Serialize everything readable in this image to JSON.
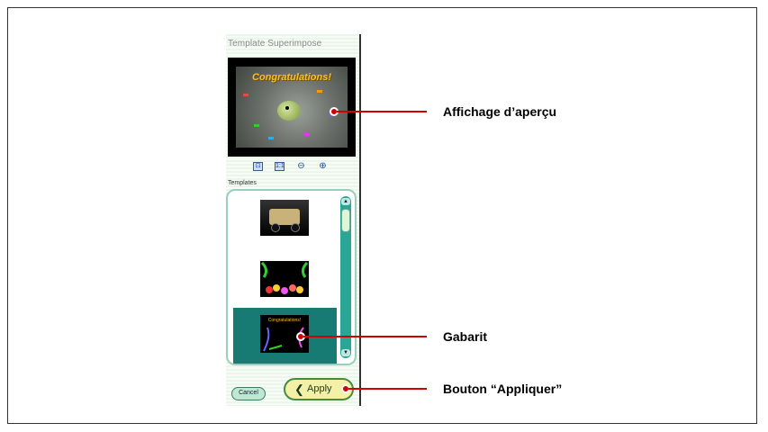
{
  "panel": {
    "title": "Template Superimpose",
    "preview_text": "Congratulations!",
    "templates_label": "Templates",
    "thumb3_text": "Congratulations!",
    "cancel_label": "Cancel",
    "apply_label": "Apply"
  },
  "toolbar": {
    "icons": [
      "fit-icon",
      "actual-size-icon",
      "zoom-out-icon",
      "zoom-in-icon"
    ]
  },
  "callouts": {
    "preview": "Affichage d’aperçu",
    "template": "Gabarit",
    "apply": "Bouton “Appliquer”"
  },
  "colors": {
    "leader": "#d40000",
    "selected_template": "#177a73",
    "scrollbar": "#29a696",
    "apply_button": "#f3f0a8"
  }
}
